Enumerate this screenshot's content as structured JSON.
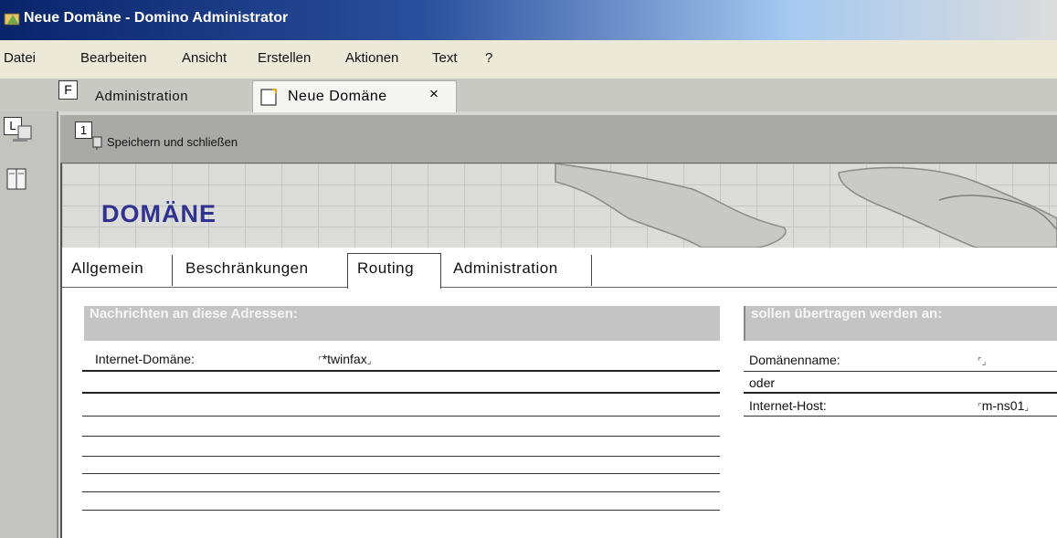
{
  "window": {
    "title": "Neue Domäne - Domino Administrator"
  },
  "menu": [
    "Datei",
    "Bearbeiten",
    "Ansicht",
    "Erstellen",
    "Aktionen",
    "Text",
    "?"
  ],
  "tabs": {
    "f_marker": "F",
    "administration": "Administration",
    "neue_domaene": "Neue Domäne",
    "close_glyph": "×"
  },
  "leftbar": {
    "l_marker": "L"
  },
  "toolbar": {
    "marker": "1",
    "save_label": "Speichern und schließen"
  },
  "banner": {
    "title": "DOMÄNE"
  },
  "form_tabs": [
    "Allgemein",
    "Beschränkungen",
    "Routing",
    "Administration"
  ],
  "form_tabs_active": "Routing",
  "left_section": {
    "header": "Nachrichten an diese Adressen:",
    "field_label": "Internet-Domäne:",
    "field_value": "*twinfax"
  },
  "right_section": {
    "header": "sollen übertragen werden an:",
    "domain_label": "Domänenname:",
    "domain_value": "",
    "or_label": "oder",
    "host_label": "Internet-Host:",
    "host_value": "m-ns01"
  },
  "colors": {
    "title_bar": "#0a246a",
    "banner_title": "#31318f",
    "section_header": "#c4c4c4"
  }
}
